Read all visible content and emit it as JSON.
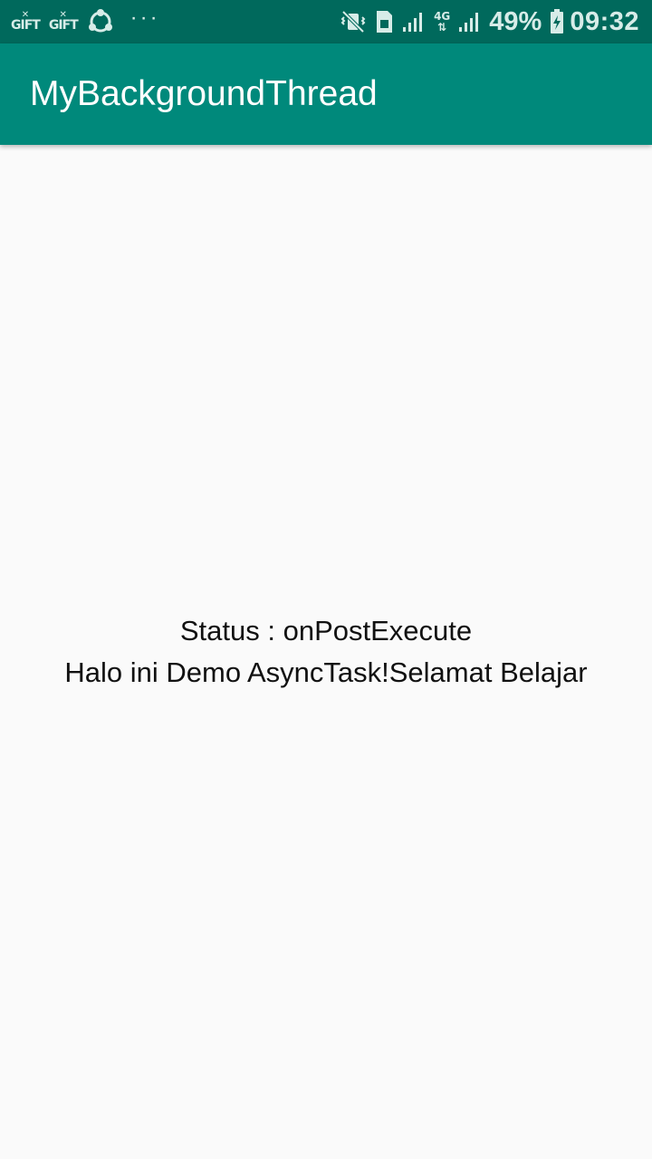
{
  "status_bar": {
    "notifications": [
      "GIFT",
      "GIFT"
    ],
    "overflow": "···",
    "network": "4G",
    "battery": "49%",
    "time": "09:32"
  },
  "app_bar": {
    "title": "MyBackgroundThread",
    "color": "#00897b"
  },
  "content": {
    "status_text": "Status : onPostExecute",
    "message_text": "Halo ini Demo AsyncTask!Selamat Belajar"
  },
  "colors": {
    "status_bar": "#00695c",
    "background": "#fafafa",
    "text": "#111111"
  }
}
